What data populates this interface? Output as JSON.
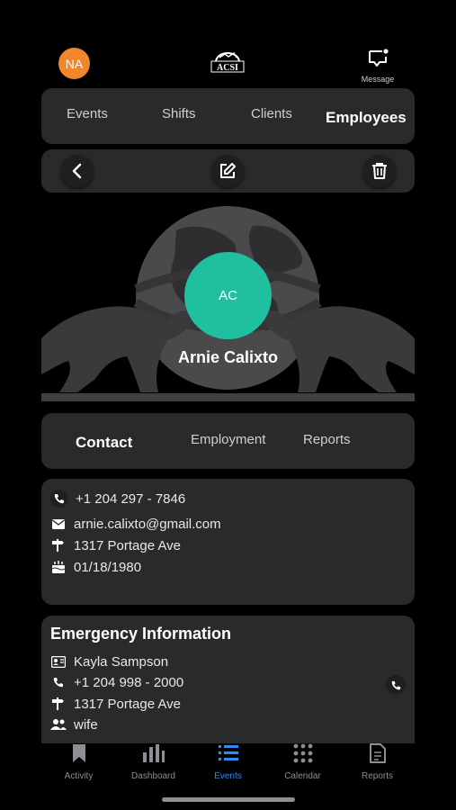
{
  "header": {
    "user_initials": "NA",
    "logo_text": "ACSI",
    "message_label": "Message"
  },
  "top_tabs": [
    "Events",
    "Shifts",
    "Clients",
    "Employees"
  ],
  "top_tabs_active": "Employees",
  "employee": {
    "initials": "AC",
    "name": "Arnie Calixto"
  },
  "sub_tabs": [
    "Contact",
    "Employment",
    "Reports"
  ],
  "sub_tabs_active": "Contact",
  "contact": {
    "phone": "+1 204 297 - 7846",
    "email": "arnie.calixto@gmail.com",
    "address": "1317 Portage Ave",
    "birthday": "01/18/1980"
  },
  "emergency": {
    "title": "Emergency Information",
    "name": "Kayla Sampson",
    "phone": "+1 204 998 - 2000",
    "address": "1317 Portage Ave",
    "relation": "wife"
  },
  "bottom_nav": [
    "Activity",
    "Dashboard",
    "Events",
    "Calendar",
    "Reports"
  ],
  "bottom_nav_active": "Events",
  "colors": {
    "accent": "#2c8cf0",
    "avatar_user": "#f0882b",
    "avatar_employee": "#1fbf9f",
    "card": "#2a2a2c"
  }
}
